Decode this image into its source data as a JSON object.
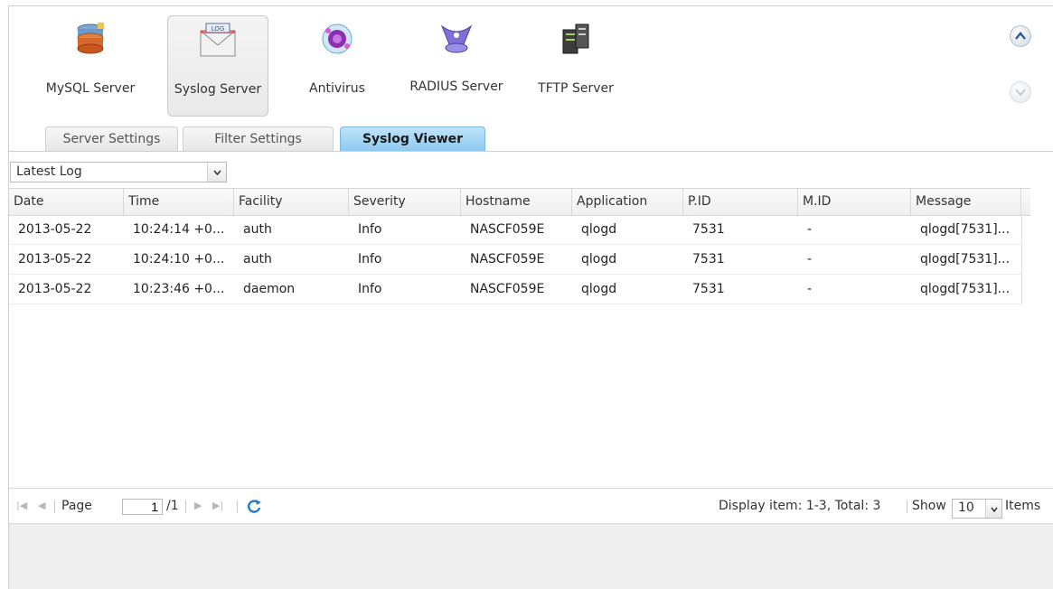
{
  "apps": [
    {
      "name": "mysql",
      "label": "MySQL Server",
      "icon": "database-icon",
      "selected": false
    },
    {
      "name": "syslog",
      "label": "Syslog Server",
      "icon": "log-envelope-icon",
      "selected": true
    },
    {
      "name": "antivirus",
      "label": "Antivirus",
      "icon": "antivirus-icon",
      "selected": false
    },
    {
      "name": "radius",
      "label": "RADIUS Server",
      "icon": "radius-icon",
      "selected": false
    },
    {
      "name": "tftp",
      "label": "TFTP Server",
      "icon": "server-rack-icon",
      "selected": false
    }
  ],
  "tabs": [
    {
      "label": "Server Settings",
      "active": false
    },
    {
      "label": "Filter Settings",
      "active": false
    },
    {
      "label": "Syslog Viewer",
      "active": true
    }
  ],
  "log_select": {
    "value": "Latest Log"
  },
  "grid": {
    "columns": [
      "Date",
      "Time",
      "Facility",
      "Severity",
      "Hostname",
      "Application",
      "P.ID",
      "M.ID",
      "Message"
    ],
    "rows": [
      [
        "2013-05-22",
        "10:24:14 +0...",
        "auth",
        "Info",
        "NASCF059E",
        "qlogd",
        "7531",
        "-",
        "qlogd[7531]..."
      ],
      [
        "2013-05-22",
        "10:24:10 +0...",
        "auth",
        "Info",
        "NASCF059E",
        "qlogd",
        "7531",
        "-",
        "qlogd[7531]..."
      ],
      [
        "2013-05-22",
        "10:23:46 +0...",
        "daemon",
        "Info",
        "NASCF059E",
        "qlogd",
        "7531",
        "-",
        "qlogd[7531]..."
      ]
    ]
  },
  "pager": {
    "page_label": "Page",
    "page_value": "1",
    "page_total": "/1",
    "display_text": "Display item: 1-3, Total: 3",
    "show_label": "Show",
    "show_value": "10",
    "items_label": "Items"
  },
  "colors": {
    "active_tab": "#8dc9ef",
    "link_icon": "#2a7fc9"
  }
}
